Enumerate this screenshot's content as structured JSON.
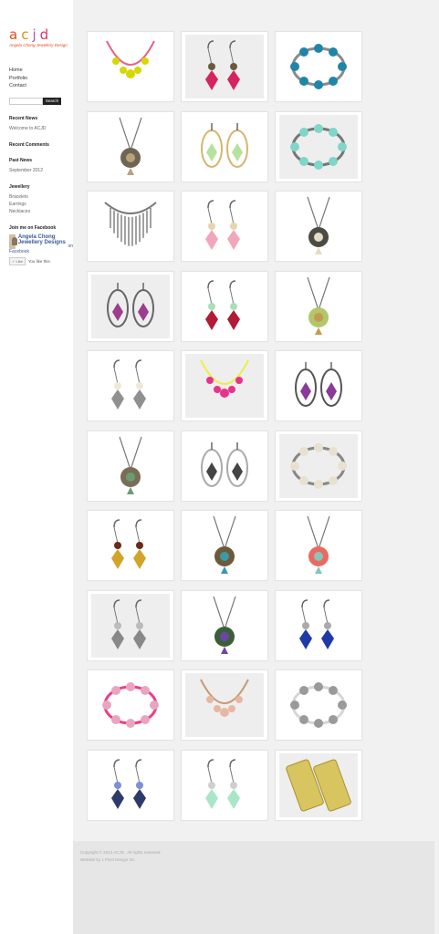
{
  "site": {
    "logo_letters": [
      "a",
      "c",
      "j",
      "d"
    ],
    "tagline": "Angela Chong Jewellery Design"
  },
  "nav": [
    "Home",
    "Portfolio",
    "Contact"
  ],
  "search": {
    "button_label": "Search",
    "placeholder": ""
  },
  "widgets": {
    "recent_news": {
      "title": "Recent News",
      "items": [
        "Welcome to ACJD"
      ]
    },
    "recent_comments": {
      "title": "Recent Comments"
    },
    "past_news": {
      "title": "Past News",
      "items": [
        "September 2012"
      ]
    },
    "jewellery": {
      "title": "Jewellery",
      "items": [
        "Bracelets",
        "Earrings",
        "Necklaces"
      ]
    },
    "facebook": {
      "title": "Join me on Facebook",
      "page_name": "Angela Chong Jewellery Designs",
      "on_label": "on",
      "fb_label": "Facebook",
      "like_button": "Like",
      "like_text": "You like this."
    }
  },
  "gallery": [
    {
      "name": "charm-necklace",
      "kind": "necklace",
      "colors": [
        "#d6d900",
        "#e8608a",
        "#caa36b"
      ]
    },
    {
      "name": "pink-drop-earrings",
      "kind": "earrings",
      "colors": [
        "#d6245e",
        "#6a5a3a"
      ]
    },
    {
      "name": "blue-bracelet",
      "kind": "bracelet",
      "colors": [
        "#1f86a8",
        "#8b8b8b"
      ]
    },
    {
      "name": "key-necklace",
      "kind": "pendant",
      "colors": [
        "#6e6555",
        "#b8a27a"
      ]
    },
    {
      "name": "green-hoop-earrings",
      "kind": "hoops",
      "colors": [
        "#b6e39c",
        "#d5b66e"
      ]
    },
    {
      "name": "aqua-bracelet",
      "kind": "bracelet",
      "colors": [
        "#7fd6c9",
        "#777"
      ]
    },
    {
      "name": "fringe-necklace",
      "kind": "fringe",
      "colors": [
        "#444",
        "#777"
      ]
    },
    {
      "name": "pink-bead-earrings",
      "kind": "earrings",
      "colors": [
        "#f2a6bb",
        "#e8d5b0"
      ]
    },
    {
      "name": "bird-nest-pendant",
      "kind": "pendant",
      "colors": [
        "#4b4b44",
        "#e4dcc5"
      ]
    },
    {
      "name": "purple-oval-earrings",
      "kind": "hoops",
      "colors": [
        "#9d3d8e",
        "#666"
      ]
    },
    {
      "name": "red-green-cluster-earrings",
      "kind": "earrings",
      "colors": [
        "#b31a35",
        "#a8e0b8"
      ]
    },
    {
      "name": "tree-pendant",
      "kind": "pendant",
      "colors": [
        "#b1c76a",
        "#c49a52"
      ]
    },
    {
      "name": "leaf-pearl-earrings",
      "kind": "earrings",
      "colors": [
        "#909090",
        "#efe8d6"
      ]
    },
    {
      "name": "pink-yellow-necklace",
      "kind": "necklace",
      "colors": [
        "#e8338a",
        "#ecef45"
      ]
    },
    {
      "name": "purple-teardrop-earrings",
      "kind": "hoops",
      "colors": [
        "#8a3a99",
        "#555"
      ]
    },
    {
      "name": "feather-pendant",
      "kind": "pendant",
      "colors": [
        "#7a6d55",
        "#6c9c72"
      ]
    },
    {
      "name": "leaf-oval-earrings",
      "kind": "hoops",
      "colors": [
        "#444",
        "#aaa"
      ]
    },
    {
      "name": "pearl-bracelet",
      "kind": "bracelet",
      "colors": [
        "#e9e1cf",
        "#888"
      ]
    },
    {
      "name": "gold-cluster-earrings",
      "kind": "earrings",
      "colors": [
        "#d3a42a",
        "#6a2a1a"
      ]
    },
    {
      "name": "clock-pendant",
      "kind": "pendant",
      "colors": [
        "#6c5a3b",
        "#3a9aa7"
      ]
    },
    {
      "name": "feather-bead-pendant",
      "kind": "pendant",
      "colors": [
        "#e96a62",
        "#8ac4b8"
      ]
    },
    {
      "name": "silver-leaf-earrings",
      "kind": "earrings",
      "colors": [
        "#888",
        "#bbb"
      ]
    },
    {
      "name": "glass-orb-pendant",
      "kind": "pendant",
      "colors": [
        "#3b5f3a",
        "#6e45a7"
      ]
    },
    {
      "name": "blue-leaf-earrings",
      "kind": "earrings",
      "colors": [
        "#1f3aa8",
        "#aaa"
      ]
    },
    {
      "name": "pink-ribbon-bracelet",
      "kind": "bracelet",
      "colors": [
        "#e9a5bf",
        "#ee3c8c"
      ]
    },
    {
      "name": "peach-bead-necklace",
      "kind": "necklace",
      "colors": [
        "#e6b8a3",
        "#c89a78"
      ]
    },
    {
      "name": "silver-chain-bracelet",
      "kind": "bracelet",
      "colors": [
        "#9a9a9a",
        "#d6d6d6"
      ]
    },
    {
      "name": "blue-crystal-earrings",
      "kind": "earrings",
      "colors": [
        "#2d3b6a",
        "#7c8fd8"
      ]
    },
    {
      "name": "mint-leaf-earrings",
      "kind": "earrings",
      "colors": [
        "#a9e6c7",
        "#cfcfcf"
      ]
    },
    {
      "name": "gold-mesh-cuffs",
      "kind": "mesh",
      "colors": [
        "#d8c560",
        "#a8922f"
      ]
    }
  ],
  "footer": {
    "copyright": "Copyright © 2013 ACJD . All rights reserved.",
    "credit": "Website by 1 Pixel Design Inc."
  }
}
